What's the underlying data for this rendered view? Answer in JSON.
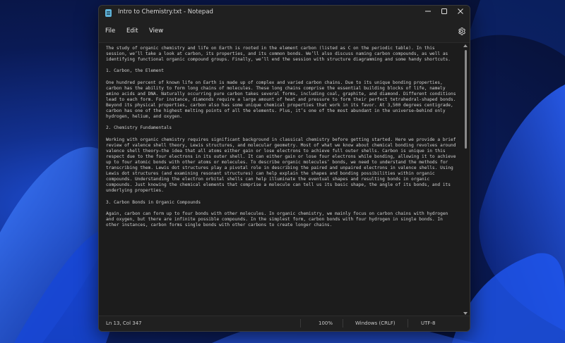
{
  "window": {
    "title": "Intro to Chemistry.txt - Notepad"
  },
  "menu": {
    "file": "File",
    "edit": "Edit",
    "view": "View"
  },
  "document": {
    "paragraphs": [
      "The study of organic chemistry and life on Earth is rooted in the element carbon (listed as C on the periodic table). In this session, we’ll take a look at carbon, its properties, and its common bonds. We’ll also discuss naming carbon compounds, as well as identifying functional organic compound groups. Finally, we’ll end the session with structure diagramming and some handy shortcuts.",
      "1. Carbon, the Element",
      "One hundred percent of known life on Earth is made up of complex and varied carbon chains. Due to its unique bonding properties, carbon has the ability to form long chains of molecules. These long chains comprise the essential building blocks of life, namely amino acids and DNA. Naturally occurring pure carbon takes several forms, including coal, graphite, and diamond. Different conditions lead to each form. For instance, diamonds require a large amount of heat and pressure to form their perfect tetrahedral-shaped bonds. Beyond its physical properties, carbon also has some unique chemical properties that work in its favor. At 3,500 degrees centigrade, carbon has one of the highest melting points of all the elements. Plus, it’s one of the most abundant in the universe—behind only hydrogen, helium, and oxygen.",
      "2. Chemistry Fundamentals",
      "Working with organic chemistry requires significant background in classical chemistry before getting started. Here we provide a brief review of valence shell theory, Lewis structures, and molecular geometry. Most of what we know about chemical bonding revolves around valence shell theory—the idea that all atoms either gain or lose electrons to achieve full outer shells. Carbon is unique in this respect due to the four electrons in its outer shell. It can either gain or lose four electrons while bonding, allowing it to achieve up to four atomic bonds with other atoms or molecules. To describe organic molecules’ bonds, we need to understand the methods for transcribing them. Lewis dot structures play a pivotal role in describing the paired and unpaired electrons in valence shells. Using Lewis dot structures (and examining resonant structures) can help explain the shapes and bonding possibilities within organic compounds. Understanding the electron orbital shells can help illuminate the eventual shapes and resulting bonds in organic compounds. Just knowing the chemical elements that comprise a molecule can tell us its basic shape, the angle of its bonds, and its underlying properties.",
      "3. Carbon Bonds in Organic Compounds",
      "Again, carbon can form up to four bonds with other molecules. In organic chemistry, we mainly focus on carbon chains with hydrogen and oxygen, but there are infinite possible compounds. In the simplest form, carbon bonds with four hydrogen in single bonds. In other instances, carbon forms single bonds with other carbons to create longer chains."
    ]
  },
  "status": {
    "position": "Ln 13, Col 347",
    "zoom": "100%",
    "line_ending": "Windows (CRLF)",
    "encoding": "UTF-8"
  },
  "icons": {
    "app": "notepad-icon",
    "settings": "gear-icon",
    "minimize": "minimize-icon",
    "maximize": "maximize-icon",
    "close": "close-icon"
  }
}
